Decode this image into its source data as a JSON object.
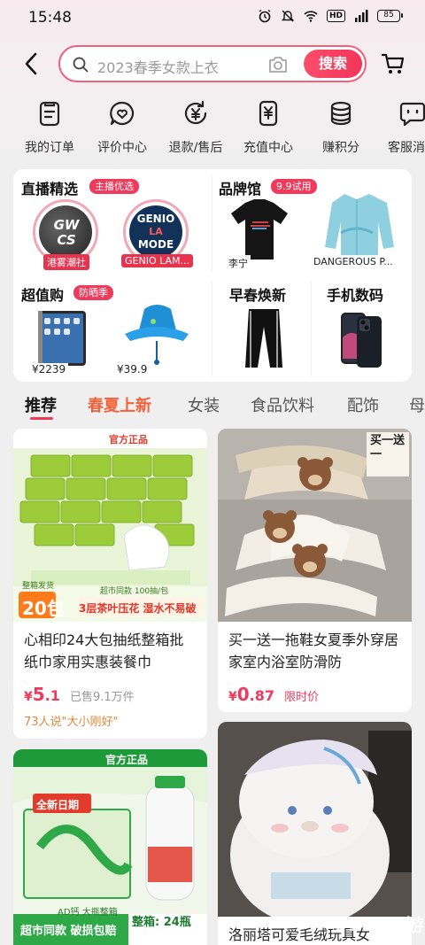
{
  "status": {
    "time": "15:48",
    "battery": "85"
  },
  "search": {
    "placeholder": "2023春季女款上衣",
    "button": "搜索"
  },
  "quick_links": [
    {
      "label": "我的订单",
      "icon": "order-icon"
    },
    {
      "label": "评价中心",
      "icon": "review-icon"
    },
    {
      "label": "退款/售后",
      "icon": "refund-icon"
    },
    {
      "label": "充值中心",
      "icon": "recharge-icon"
    },
    {
      "label": "赚积分",
      "icon": "coins-icon"
    },
    {
      "label": "客服消",
      "icon": "service-icon"
    }
  ],
  "promo": {
    "live": {
      "title": "直播精选",
      "tag": "主播优选",
      "anchors": [
        "港雾潮社",
        "GENIO LAM..."
      ],
      "logo1": "GW CS",
      "logo2_lines": [
        "GENIO",
        "LA",
        "MODE"
      ]
    },
    "brand": {
      "title": "品牌馆",
      "tag": "9.9试用",
      "items": [
        "李宁",
        "DANGEROUS P..."
      ]
    },
    "value": {
      "title": "超值购",
      "tag": "防晒季",
      "prices": [
        "¥2239",
        "¥39.9"
      ]
    },
    "spring": {
      "title": "早春焕新"
    },
    "digital": {
      "title": "手机数码"
    }
  },
  "tabs": [
    "推荐",
    "春夏上新",
    "女装",
    "食品饮料",
    "配饰",
    "母"
  ],
  "products": [
    {
      "title": "心相印24大包抽纸整箱批纸巾家用实惠装餐巾",
      "price_int": "5",
      "price_dec": ".1",
      "meta": "已售9.1万件",
      "hint": "73人说\"大小刚好\"",
      "img_brand": "官方正品",
      "img_pack": "20包",
      "img_slogan": "3层茶叶压花 湿水不易破",
      "img_label": "整箱发货",
      "img_sub": "超市同款 100抽/包"
    },
    {
      "title": "买一送一拖鞋女夏季外穿居家室内浴室防滑防",
      "price_int": "0",
      "price_dec": ".87",
      "meta": "限时价",
      "img_badge": "买一送一"
    },
    {
      "title": "",
      "img_brand": "官方正品",
      "img_new": "全新日期",
      "img_label": "AD钙 大瓶整箱",
      "img_sub": "超市同款 破损包赔",
      "img_count": "整箱: 24瓶"
    },
    {
      "title": "洛丽塔可爱毛绒玩具女"
    }
  ],
  "watermark": "9196下游网",
  "colors": {
    "accent": "#f03a5c",
    "hot_tab": "#f2613a",
    "hint": "#e2893a"
  }
}
